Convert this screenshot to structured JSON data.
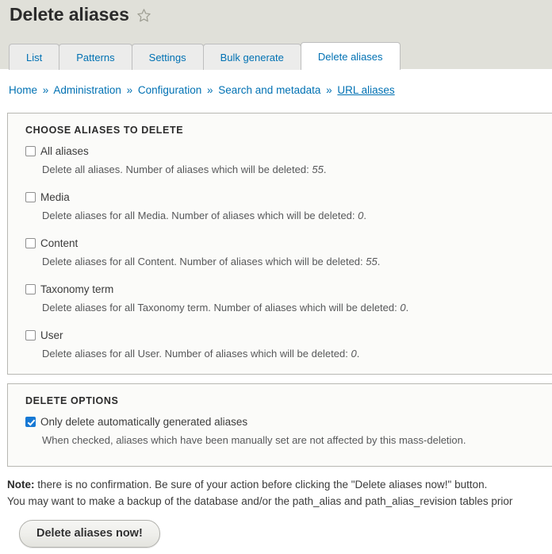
{
  "page": {
    "title": "Delete aliases",
    "favorite_icon": "star-outline-icon"
  },
  "tabs": [
    {
      "label": "List",
      "active": false
    },
    {
      "label": "Patterns",
      "active": false
    },
    {
      "label": "Settings",
      "active": false
    },
    {
      "label": "Bulk generate",
      "active": false
    },
    {
      "label": "Delete aliases",
      "active": true
    }
  ],
  "breadcrumb": {
    "separator": "»",
    "items": [
      {
        "label": "Home",
        "current": false
      },
      {
        "label": "Administration",
        "current": false
      },
      {
        "label": "Configuration",
        "current": false
      },
      {
        "label": "Search and metadata",
        "current": false
      },
      {
        "label": "URL aliases",
        "current": true
      }
    ]
  },
  "choose_fieldset": {
    "legend": "Choose aliases to delete",
    "options": [
      {
        "label": "All aliases",
        "checked": false,
        "description_prefix": "Delete all aliases. Number of aliases which will be deleted: ",
        "count": "55",
        "description_suffix": "."
      },
      {
        "label": "Media",
        "checked": false,
        "description_prefix": "Delete aliases for all Media. Number of aliases which will be deleted: ",
        "count": "0",
        "description_suffix": "."
      },
      {
        "label": "Content",
        "checked": false,
        "description_prefix": "Delete aliases for all Content. Number of aliases which will be deleted: ",
        "count": "55",
        "description_suffix": "."
      },
      {
        "label": "Taxonomy term",
        "checked": false,
        "description_prefix": "Delete aliases for all Taxonomy term. Number of aliases which will be deleted: ",
        "count": "0",
        "description_suffix": "."
      },
      {
        "label": "User",
        "checked": false,
        "description_prefix": "Delete aliases for all User. Number of aliases which will be deleted: ",
        "count": "0",
        "description_suffix": "."
      }
    ]
  },
  "options_fieldset": {
    "legend": "Delete options",
    "options": [
      {
        "label": "Only delete automatically generated aliases",
        "checked": true,
        "description_prefix": "When checked, aliases which have been manually set are not affected by this mass-deletion.",
        "count": "",
        "description_suffix": ""
      }
    ]
  },
  "note": {
    "strong": "Note:",
    "line1": " there is no confirmation. Be sure of your action before clicking the \"Delete aliases now!\" button.",
    "line2": "You may want to make a backup of the database and/or the path_alias and path_alias_revision tables prior"
  },
  "submit": {
    "label": "Delete aliases now!"
  },
  "colors": {
    "header_background": "#e0e0d9",
    "link": "#0071b3",
    "checkbox_accent": "#1678d4",
    "fieldset_background": "#fbfbf9",
    "fieldset_border": "#b8b8b3"
  }
}
